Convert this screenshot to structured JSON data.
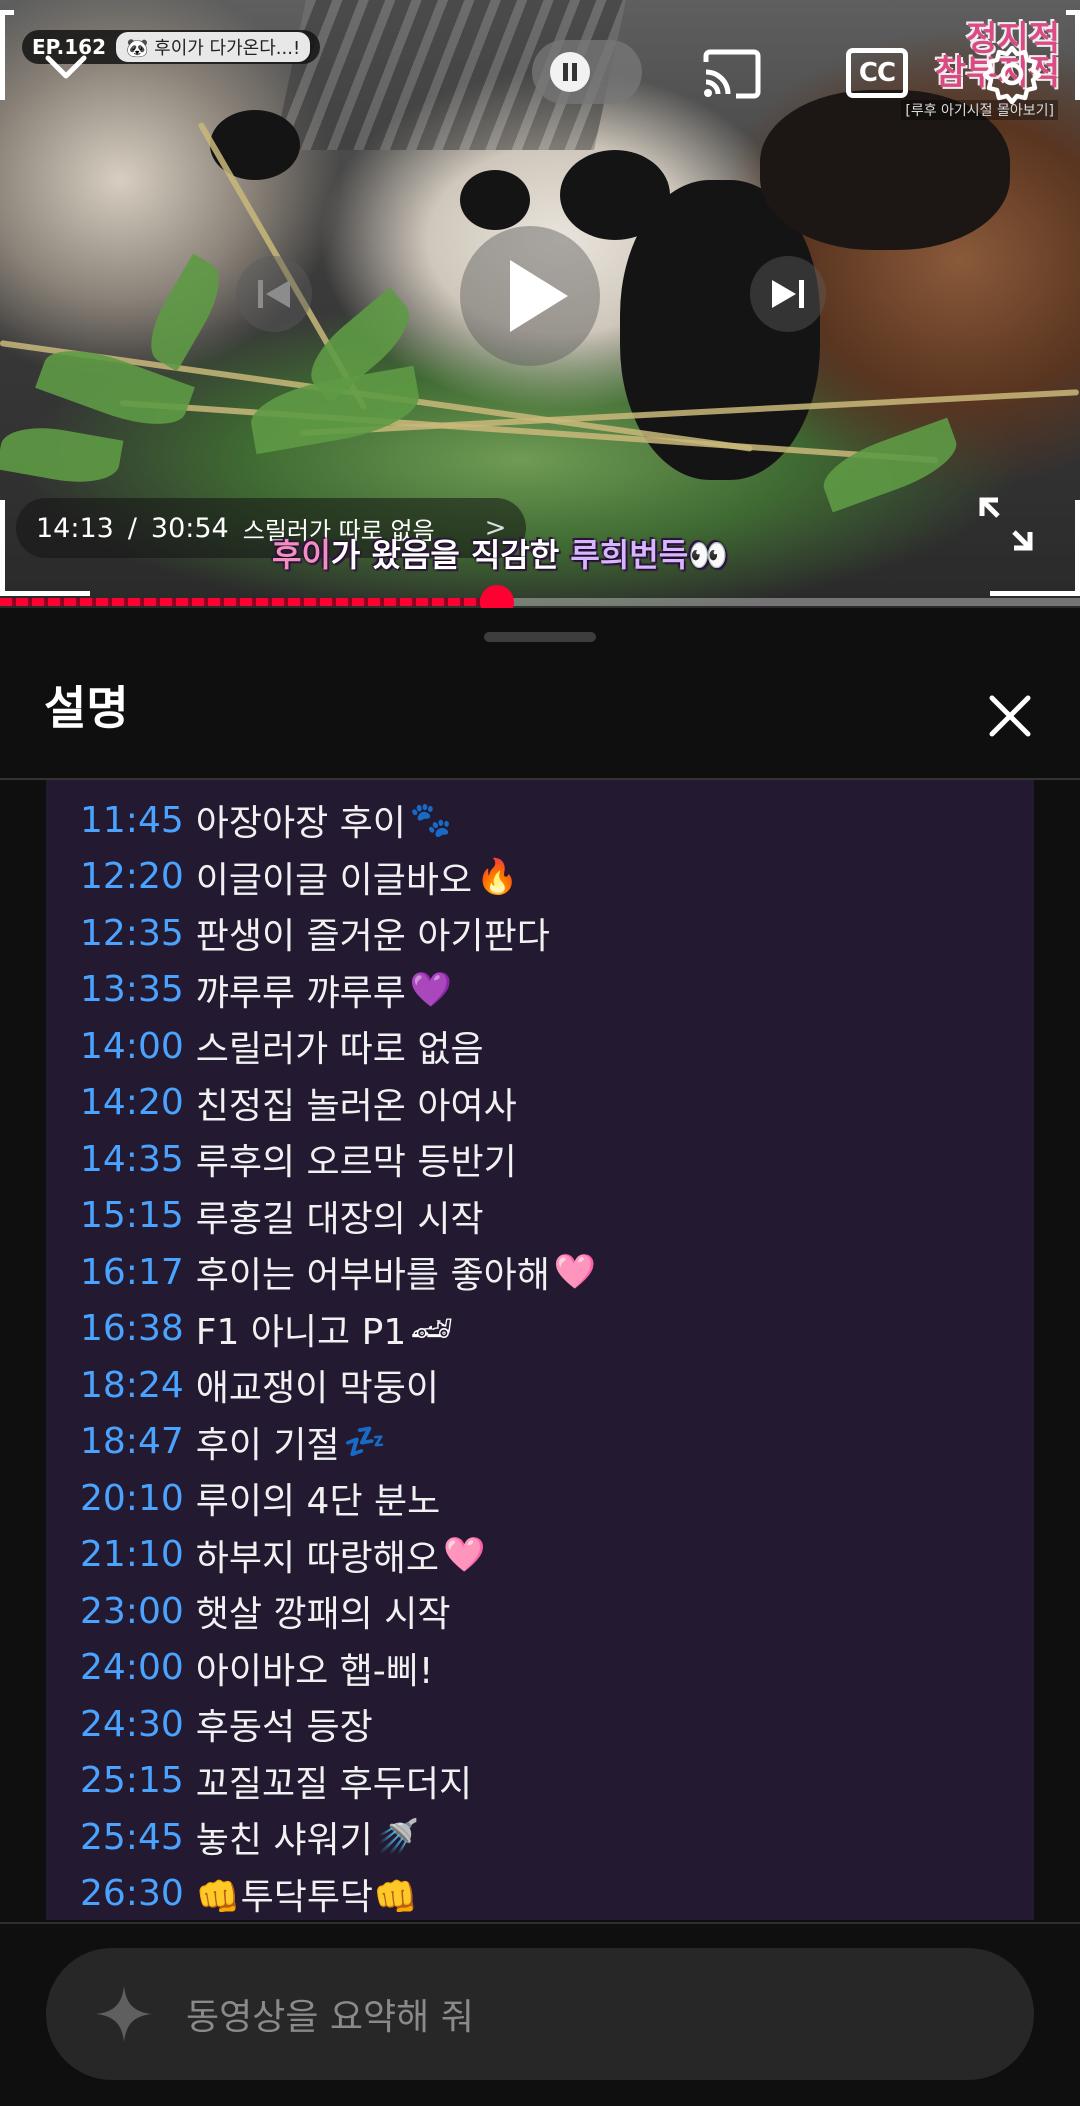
{
  "player": {
    "episode_badge": "EP.162",
    "episode_title": "🐼 후이가 다가온다...!",
    "channel_logo": "정지적\n참부지적",
    "channel_sub": "[루후 아기시절 몰아보기]",
    "cc_label": "CC",
    "current_time": "14:13",
    "time_separator": "/",
    "duration": "30:54",
    "chapter_title": "스릴러가 따로 없음",
    "chapter_chevron": ">",
    "burned_subtitle": {
      "part1": "후이",
      "part2": "가 왔음을 ",
      "part3": "직감한 ",
      "part4": "루희번득👀"
    },
    "progress_fraction": 0.46,
    "progress_color": "#ff0033"
  },
  "panel": {
    "title": "설명",
    "chapters": [
      {
        "time": "11:45",
        "label": "아장아장 후이",
        "emoji": "🐾"
      },
      {
        "time": "12:20",
        "label": "이글이글 이글바오",
        "emoji": "🔥"
      },
      {
        "time": "12:35",
        "label": "판생이 즐거운 아기판다",
        "emoji": ""
      },
      {
        "time": "13:35",
        "label": "꺄루루 꺄루루",
        "emoji": "💜"
      },
      {
        "time": "14:00",
        "label": "스릴러가 따로 없음",
        "emoji": ""
      },
      {
        "time": "14:20",
        "label": "친정집 놀러온 아여사",
        "emoji": ""
      },
      {
        "time": "14:35",
        "label": "루후의 오르막 등반기",
        "emoji": ""
      },
      {
        "time": "15:15",
        "label": "루홍길 대장의 시작",
        "emoji": ""
      },
      {
        "time": "16:17",
        "label": "후이는 어부바를 좋아해",
        "emoji": "🩷"
      },
      {
        "time": "16:38",
        "label": "F1 아니고 P1",
        "emoji": "🏎"
      },
      {
        "time": "18:24",
        "label": "애교쟁이 막둥이",
        "emoji": ""
      },
      {
        "time": "18:47",
        "label": "후이 기절",
        "emoji": "💤"
      },
      {
        "time": "20:10",
        "label": "루이의 4단 분노",
        "emoji": ""
      },
      {
        "time": "21:10",
        "label": "하부지 따랑해오",
        "emoji": "🩷"
      },
      {
        "time": "23:00",
        "label": "햇살 깡패의 시작",
        "emoji": ""
      },
      {
        "time": "24:00",
        "label": "아이바오 햅-삐!",
        "emoji": ""
      },
      {
        "time": "24:30",
        "label": "후동석 등장",
        "emoji": ""
      },
      {
        "time": "25:15",
        "label": "꼬질꼬질 후두더지",
        "emoji": ""
      },
      {
        "time": "25:45",
        "label": "놓친 샤워기",
        "emoji": "🚿"
      },
      {
        "time": "26:30",
        "label": "👊투닥투닥👊",
        "emoji": ""
      }
    ],
    "ask_placeholder": "동영상을 요약해 줘"
  },
  "colors": {
    "timestamp": "#4aa3ff",
    "description_bg": "#231a31",
    "background": "#0f0f0f"
  },
  "icons": [
    "chevron-down-icon",
    "pause-icon",
    "cast-icon",
    "settings-gear-icon",
    "previous-icon",
    "play-icon",
    "next-icon",
    "fullscreen-icon",
    "close-icon",
    "sparkle-icon"
  ]
}
